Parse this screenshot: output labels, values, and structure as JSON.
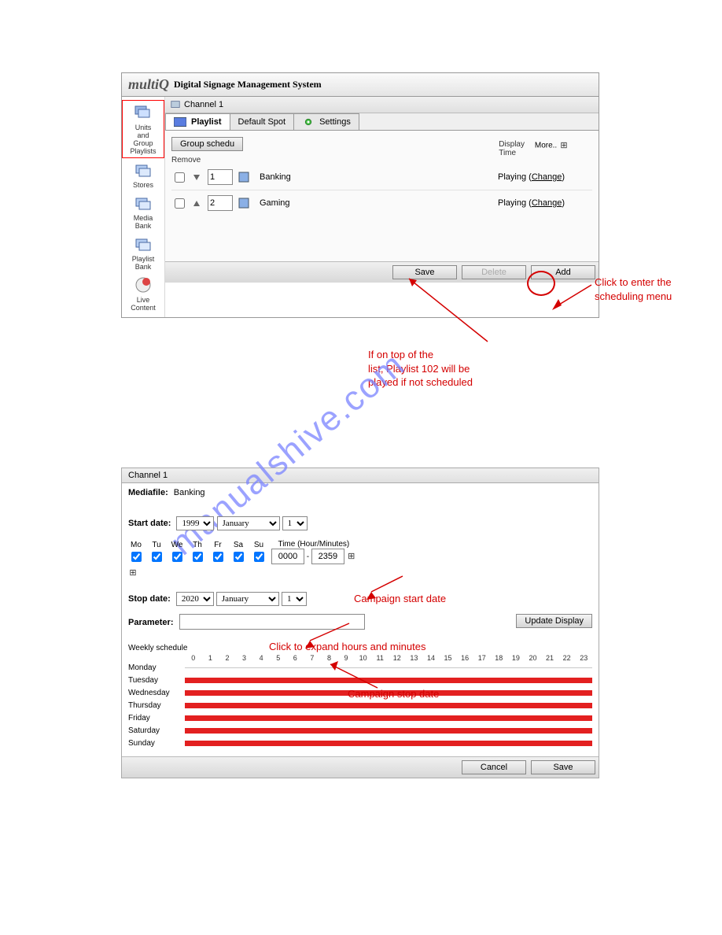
{
  "header": {
    "brand": "multiQ",
    "system": "Digital Signage Management System"
  },
  "sidebar": {
    "items": [
      {
        "label": "Units\nand\nGroup\nPlaylists",
        "icon": "monitor-stack-icon"
      },
      {
        "label": "Stores",
        "icon": "store-icon"
      },
      {
        "label": "Media\nBank",
        "icon": "folder-stack-icon"
      },
      {
        "label": "Playlist\nBank",
        "icon": "playlist-icon"
      },
      {
        "label": "Live\nContent",
        "icon": "live-icon"
      }
    ]
  },
  "channel": {
    "crumb": "Channel 1",
    "tabs": [
      {
        "label": "Playlist",
        "icon": "monitor-icon",
        "active": true
      },
      {
        "label": "Default Spot",
        "icon": "",
        "active": false
      },
      {
        "label": "Settings",
        "icon": "gear-icon",
        "active": false
      }
    ],
    "group_button": "Group schedu",
    "columns": {
      "remove": "Remove",
      "display_time": "Display\nTime",
      "more": "More.."
    },
    "rows": [
      {
        "order": "1",
        "name": "Banking",
        "status": "Playing",
        "change": "Change"
      },
      {
        "order": "2",
        "name": "Gaming",
        "status": "Playing",
        "change": "Change"
      }
    ],
    "actions": {
      "save": "Save",
      "delete": "Delete",
      "add": "Add"
    }
  },
  "annotations": {
    "top_right": "Click to enter the\nscheduling menu",
    "center": "If on top of the\nlist, Playlist 102 will be\nplayed if not scheduled",
    "start": "Campaign start date",
    "expand": "Click to expand hours and minutes",
    "stop": "Campaign stop date"
  },
  "watermark": "manualshive.com",
  "schedule": {
    "head": "Channel 1",
    "mediafile_label": "Mediafile:",
    "mediafile_value": "Banking",
    "start_label": "Start date:",
    "start": {
      "year": "1999",
      "month": "January",
      "day": "1"
    },
    "days": {
      "labels": [
        "Mo",
        "Tu",
        "We",
        "Th",
        "Fr",
        "Sa",
        "Su"
      ],
      "time_label": "Time (Hour/Minutes)",
      "from": "0000",
      "to": "2359"
    },
    "stop_label": "Stop date:",
    "stop": {
      "year": "2020",
      "month": "January",
      "day": "1"
    },
    "param_label": "Parameter:",
    "param_value": "",
    "update": "Update Display",
    "ws_title": "Weekly schedule",
    "hours": [
      "0",
      "1",
      "2",
      "3",
      "4",
      "5",
      "6",
      "7",
      "8",
      "9",
      "10",
      "11",
      "12",
      "13",
      "14",
      "15",
      "16",
      "17",
      "18",
      "19",
      "20",
      "21",
      "22",
      "23"
    ],
    "week": [
      "Monday",
      "Tuesday",
      "Wednesday",
      "Thursday",
      "Friday",
      "Saturday",
      "Sunday"
    ],
    "cancel": "Cancel",
    "save": "Save"
  }
}
